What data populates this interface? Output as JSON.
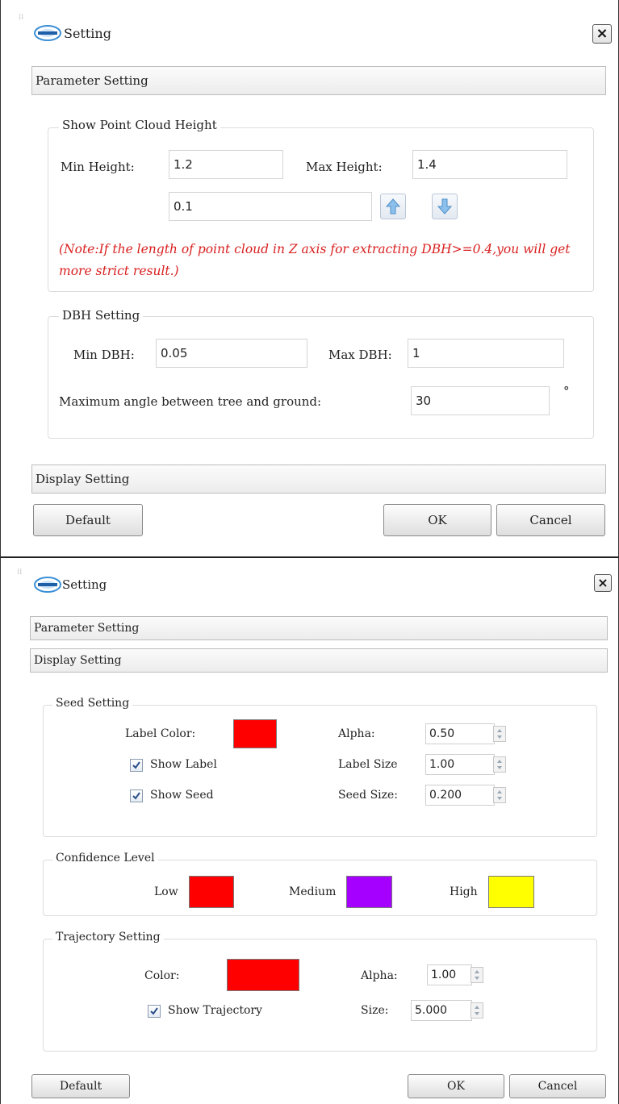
{
  "dialog1": {
    "title": "Setting",
    "close": "×",
    "parameter_section": "Parameter Setting",
    "height_group": {
      "title": "Show Point Cloud Height",
      "min_label": "Min Height:",
      "min_value": "1.2",
      "max_label": "Max Height:",
      "max_value": "1.4",
      "step_value": "0.1",
      "note": "(Note:If the length of point cloud in Z axis for extracting DBH>=0.4,you will get more strict result.)"
    },
    "dbh_group": {
      "title": "DBH Setting",
      "min_label": "Min DBH:",
      "min_value": "0.05",
      "max_label": "Max DBH:",
      "max_value": "1",
      "angle_label": "Maximum angle between tree and ground:",
      "angle_value": "30",
      "degree": "°"
    },
    "display_section": "Display Setting",
    "buttons": {
      "default": "Default",
      "ok": "OK",
      "cancel": "Cancel"
    }
  },
  "dialog2": {
    "title": "Setting",
    "close": "×",
    "parameter_section": "Parameter Setting",
    "display_section": "Display Setting",
    "seed_group": {
      "title": "Seed Setting",
      "label_color_label": "Label Color:",
      "label_color": "#ff0000",
      "alpha_label": "Alpha:",
      "alpha_value": "0.50",
      "show_label": "Show Label",
      "show_label_checked": true,
      "label_size_label": "Label Size",
      "label_size_value": "1.00",
      "show_seed": "Show Seed",
      "show_seed_checked": true,
      "seed_size_label": "Seed Size:",
      "seed_size_value": "0.200"
    },
    "confidence_group": {
      "title": "Confidence Level",
      "low_label": "Low",
      "low_color": "#ff0000",
      "medium_label": "Medium",
      "medium_color": "#a500ff",
      "high_label": "High",
      "high_color": "#ffff00"
    },
    "trajectory_group": {
      "title": "Trajectory Setting",
      "color_label": "Color:",
      "color": "#ff0000",
      "alpha_label": "Alpha:",
      "alpha_value": "1.00",
      "show_trajectory": "Show Trajectory",
      "show_trajectory_checked": true,
      "size_label": "Size:",
      "size_value": "5.000"
    },
    "buttons": {
      "default": "Default",
      "ok": "OK",
      "cancel": "Cancel"
    }
  }
}
